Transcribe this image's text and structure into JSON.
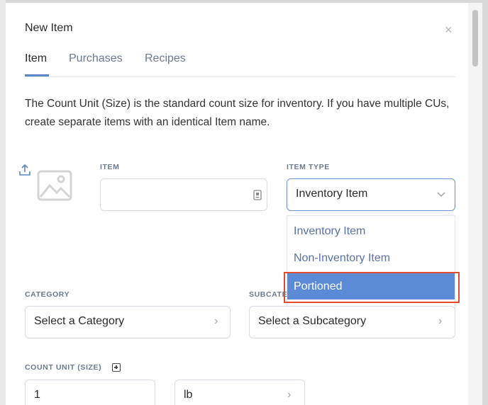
{
  "modal": {
    "title": "New Item",
    "close_icon": "close-icon"
  },
  "tabs": [
    {
      "label": "Item",
      "active": true
    },
    {
      "label": "Purchases",
      "active": false
    },
    {
      "label": "Recipes",
      "active": false
    }
  ],
  "description": "The Count Unit (Size) is the standard count size for inventory. If you have multiple CUs, create separate items with an identical Item name.",
  "item": {
    "label": "ITEM",
    "value": "",
    "icon": "id-card-icon"
  },
  "item_type": {
    "label": "ITEM TYPE",
    "value": "Inventory Item",
    "options": [
      "Inventory Item",
      "Non-Inventory Item",
      "Portioned"
    ],
    "highlighted_option": "Portioned"
  },
  "category": {
    "label": "CATEGORY",
    "value": "Select a Category"
  },
  "subcategory": {
    "label": "SUBCATE",
    "value": "Select a Subcategory"
  },
  "count_unit": {
    "label": "COUNT UNIT (SIZE)",
    "quantity": "1",
    "unit": "lb"
  },
  "colors": {
    "accent": "#5b8ad6",
    "highlight_border": "#e24b32"
  }
}
